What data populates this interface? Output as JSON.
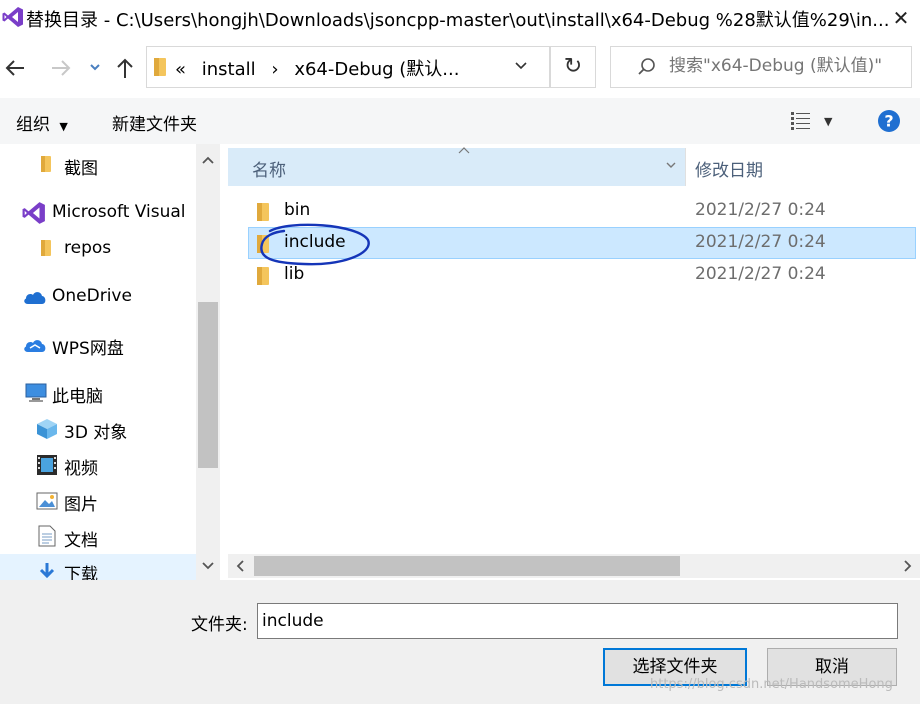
{
  "window": {
    "title": "替换目录 - C:\\Users\\hongjh\\Downloads\\jsoncpp-master\\out\\install\\x64-Debug %28默认值%29\\in..."
  },
  "address": {
    "overflow": "«",
    "segments": [
      "install",
      "x64-Debug (默认..."
    ]
  },
  "search": {
    "placeholder": "搜索\"x64-Debug (默认值)\""
  },
  "toolbar": {
    "organize": "组织",
    "new_folder": "新建文件夹"
  },
  "nav": {
    "items": [
      {
        "label": "截图",
        "icon": "folder-icon"
      },
      {
        "label": "Microsoft Visual",
        "icon": "visual-studio-icon"
      },
      {
        "label": "repos",
        "icon": "folder-icon"
      },
      {
        "label": "OneDrive",
        "icon": "cloud-icon"
      },
      {
        "label": "WPS网盘",
        "icon": "cloud-icon"
      },
      {
        "label": "此电脑",
        "icon": "computer-icon"
      },
      {
        "label": "3D 对象",
        "icon": "cube-icon"
      },
      {
        "label": "视频",
        "icon": "video-icon"
      },
      {
        "label": "图片",
        "icon": "picture-icon"
      },
      {
        "label": "文档",
        "icon": "document-icon"
      },
      {
        "label": "下载",
        "icon": "download-icon"
      }
    ]
  },
  "files": {
    "columns": {
      "name": "名称",
      "date": "修改日期"
    },
    "rows": [
      {
        "name": "bin",
        "date": "2021/2/27 0:24"
      },
      {
        "name": "include",
        "date": "2021/2/27 0:24"
      },
      {
        "name": "lib",
        "date": "2021/2/27 0:24"
      }
    ]
  },
  "footer": {
    "folder_label": "文件夹:",
    "folder_value": "include",
    "select_button": "选择文件夹",
    "cancel_button": "取消",
    "watermark": "https://blog.csdn.net/HandsomeHong"
  },
  "colors": {
    "accent": "#0078d7",
    "selection": "#cce8ff",
    "folder": "#f4c55c",
    "annotation": "#1535b8"
  }
}
